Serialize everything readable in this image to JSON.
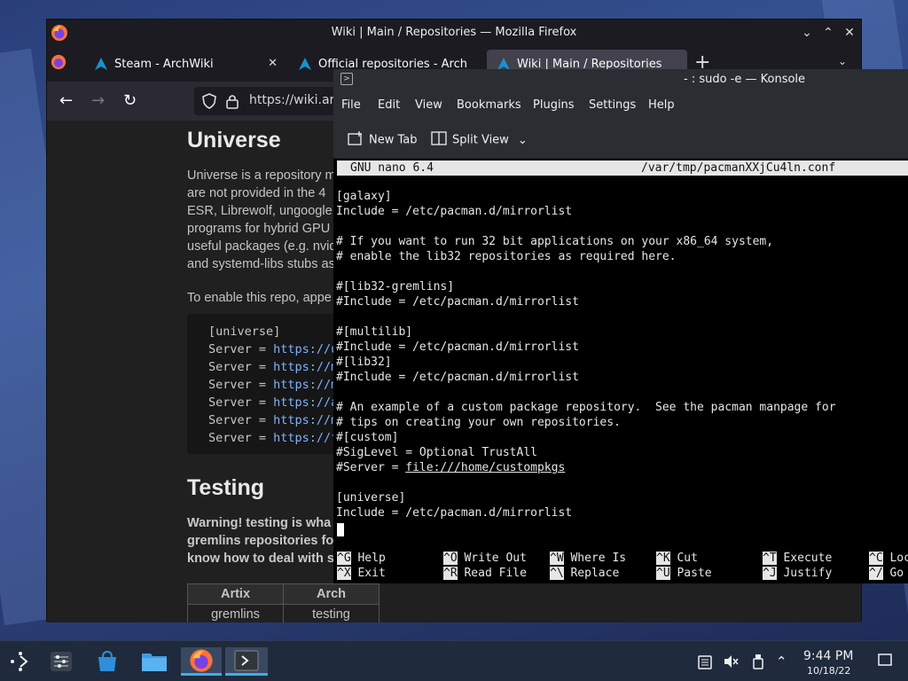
{
  "firefox": {
    "window_title": "Wiki | Main / Repositories — Mozilla Firefox",
    "tabs": [
      {
        "label": "Steam - ArchWiki"
      },
      {
        "label": "Official repositories - Arch"
      },
      {
        "label": "Wiki | Main / Repositories"
      }
    ],
    "url": "https://wiki.art"
  },
  "wiki": {
    "heading_universe": "Universe",
    "universe_lines": [
      "Universe is a repository m",
      "are not provided in the 4",
      "ESR, Librewolf, ungoogle",
      "programs for hybrid GPU",
      "useful packages (e.g. nvid",
      "and systemd-libs stubs as"
    ],
    "enable_text": "To enable this repo, appe",
    "code_lines": [
      {
        "key": "[universe]",
        "link": ""
      },
      {
        "key": "Server = ",
        "link": "https://u"
      },
      {
        "key": "Server = ",
        "link": "https://m"
      },
      {
        "key": "Server = ",
        "link": "https://m"
      },
      {
        "key": "Server = ",
        "link": "https://a"
      },
      {
        "key": "Server = ",
        "link": "https://m"
      },
      {
        "key": "Server = ",
        "link": "https://f"
      }
    ],
    "heading_testing": "Testing",
    "warning_lines": [
      "Warning! testing is wha",
      "gremlins repositories fo",
      "know how to deal with s"
    ],
    "table": {
      "headers": [
        "Artix",
        "Arch"
      ],
      "rows": [
        [
          "gremlins",
          "testing"
        ]
      ]
    }
  },
  "konsole": {
    "window_title": "- : sudo -e — Konsole",
    "menu": [
      "File",
      "Edit",
      "View",
      "Bookmarks",
      "Plugins",
      "Settings",
      "Help"
    ],
    "toolbar": {
      "new_tab": "New Tab",
      "split_view": "Split View"
    },
    "nano_version": "GNU nano 6.4",
    "nano_file": "/var/tmp/pacmanXXjCu4ln.conf",
    "lines": [
      "[galaxy]",
      "Include = /etc/pacman.d/mirrorlist",
      "",
      "# If you want to run 32 bit applications on your x86_64 system,",
      "# enable the lib32 repositories as required here.",
      "",
      "#[lib32-gremlins]",
      "#Include = /etc/pacman.d/mirrorlist",
      "",
      "#[multilib]",
      "#Include = /etc/pacman.d/mirrorlist",
      "#[lib32]",
      "#Include = /etc/pacman.d/mirrorlist",
      "",
      "# An example of a custom package repository.  See the pacman manpage for",
      "# tips on creating your own repositories.",
      "#[custom]",
      "#SigLevel = Optional TrustAll",
      "#Server = ",
      "",
      "[universe]",
      "Include = /etc/pacman.d/mirrorlist"
    ],
    "server_url": "file:///home/custompkgs",
    "shortcuts_row1": [
      {
        "key": "^G",
        "label": "Help"
      },
      {
        "key": "^O",
        "label": "Write Out"
      },
      {
        "key": "^W",
        "label": "Where Is"
      },
      {
        "key": "^K",
        "label": "Cut"
      },
      {
        "key": "^T",
        "label": "Execute"
      },
      {
        "key": "^C",
        "label": "Loc"
      }
    ],
    "shortcuts_row2": [
      {
        "key": "^X",
        "label": "Exit"
      },
      {
        "key": "^R",
        "label": "Read File"
      },
      {
        "key": "^\\",
        "label": "Replace"
      },
      {
        "key": "^U",
        "label": "Paste"
      },
      {
        "key": "^J",
        "label": "Justify"
      },
      {
        "key": "^/",
        "label": "Go"
      }
    ]
  },
  "taskbar": {
    "time": "9:44 PM",
    "date": "10/18/22"
  },
  "colors": {
    "accent": "#3daee9",
    "terminal_bg": "#000000",
    "link": "#7fb2ff"
  }
}
